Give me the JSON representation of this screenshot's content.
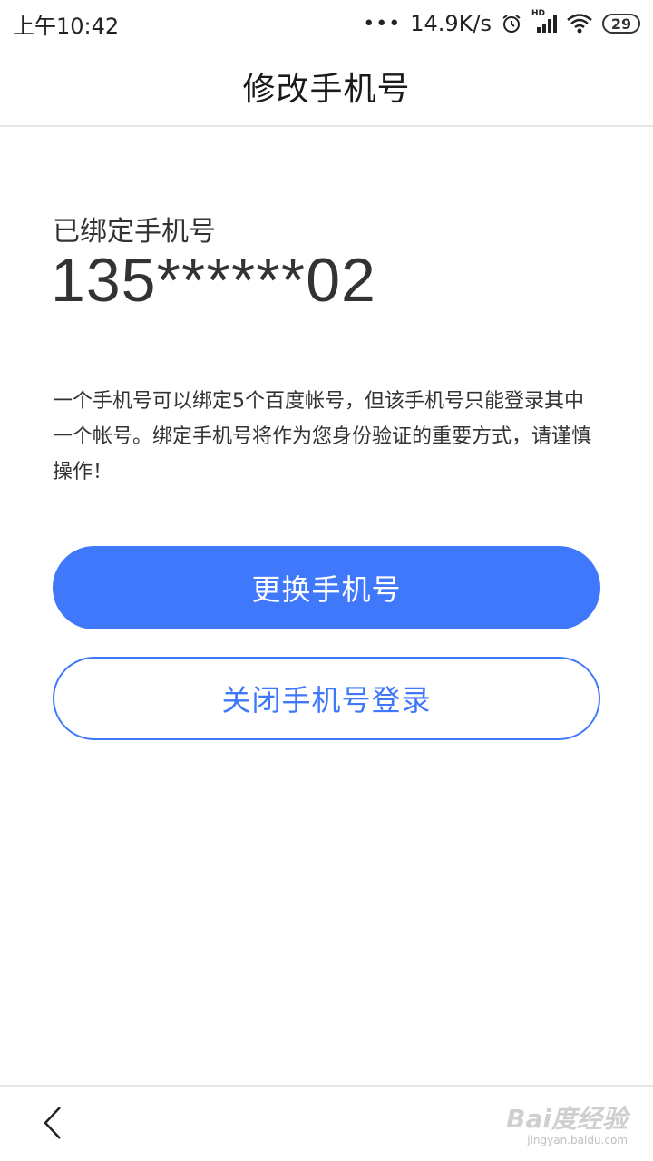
{
  "status_bar": {
    "time": "上午10:42",
    "net_speed": "14.9K/s",
    "signal_badge": "HD",
    "battery": "29",
    "icons": [
      "dots-icon",
      "alarm-icon",
      "signal-icon",
      "wifi-icon",
      "battery-icon"
    ]
  },
  "header": {
    "title": "修改手机号"
  },
  "content": {
    "bound_label": "已绑定手机号",
    "bound_number": "135******02",
    "notice": "一个手机号可以绑定5个百度帐号，但该手机号只能登录其中一个帐号。绑定手机号将作为您身份验证的重要方式，请谨慎操作！"
  },
  "buttons": {
    "change_label": "更换手机号",
    "close_label": "关闭手机号登录"
  },
  "bottom_bar": {
    "back_icon": "chevron-left-icon",
    "watermark_main": "Bai度经验",
    "watermark_sub": "jingyan.baidu.com"
  },
  "colors": {
    "accent": "#3f78fb",
    "text": "#333333",
    "divider": "#e6e6e6"
  }
}
